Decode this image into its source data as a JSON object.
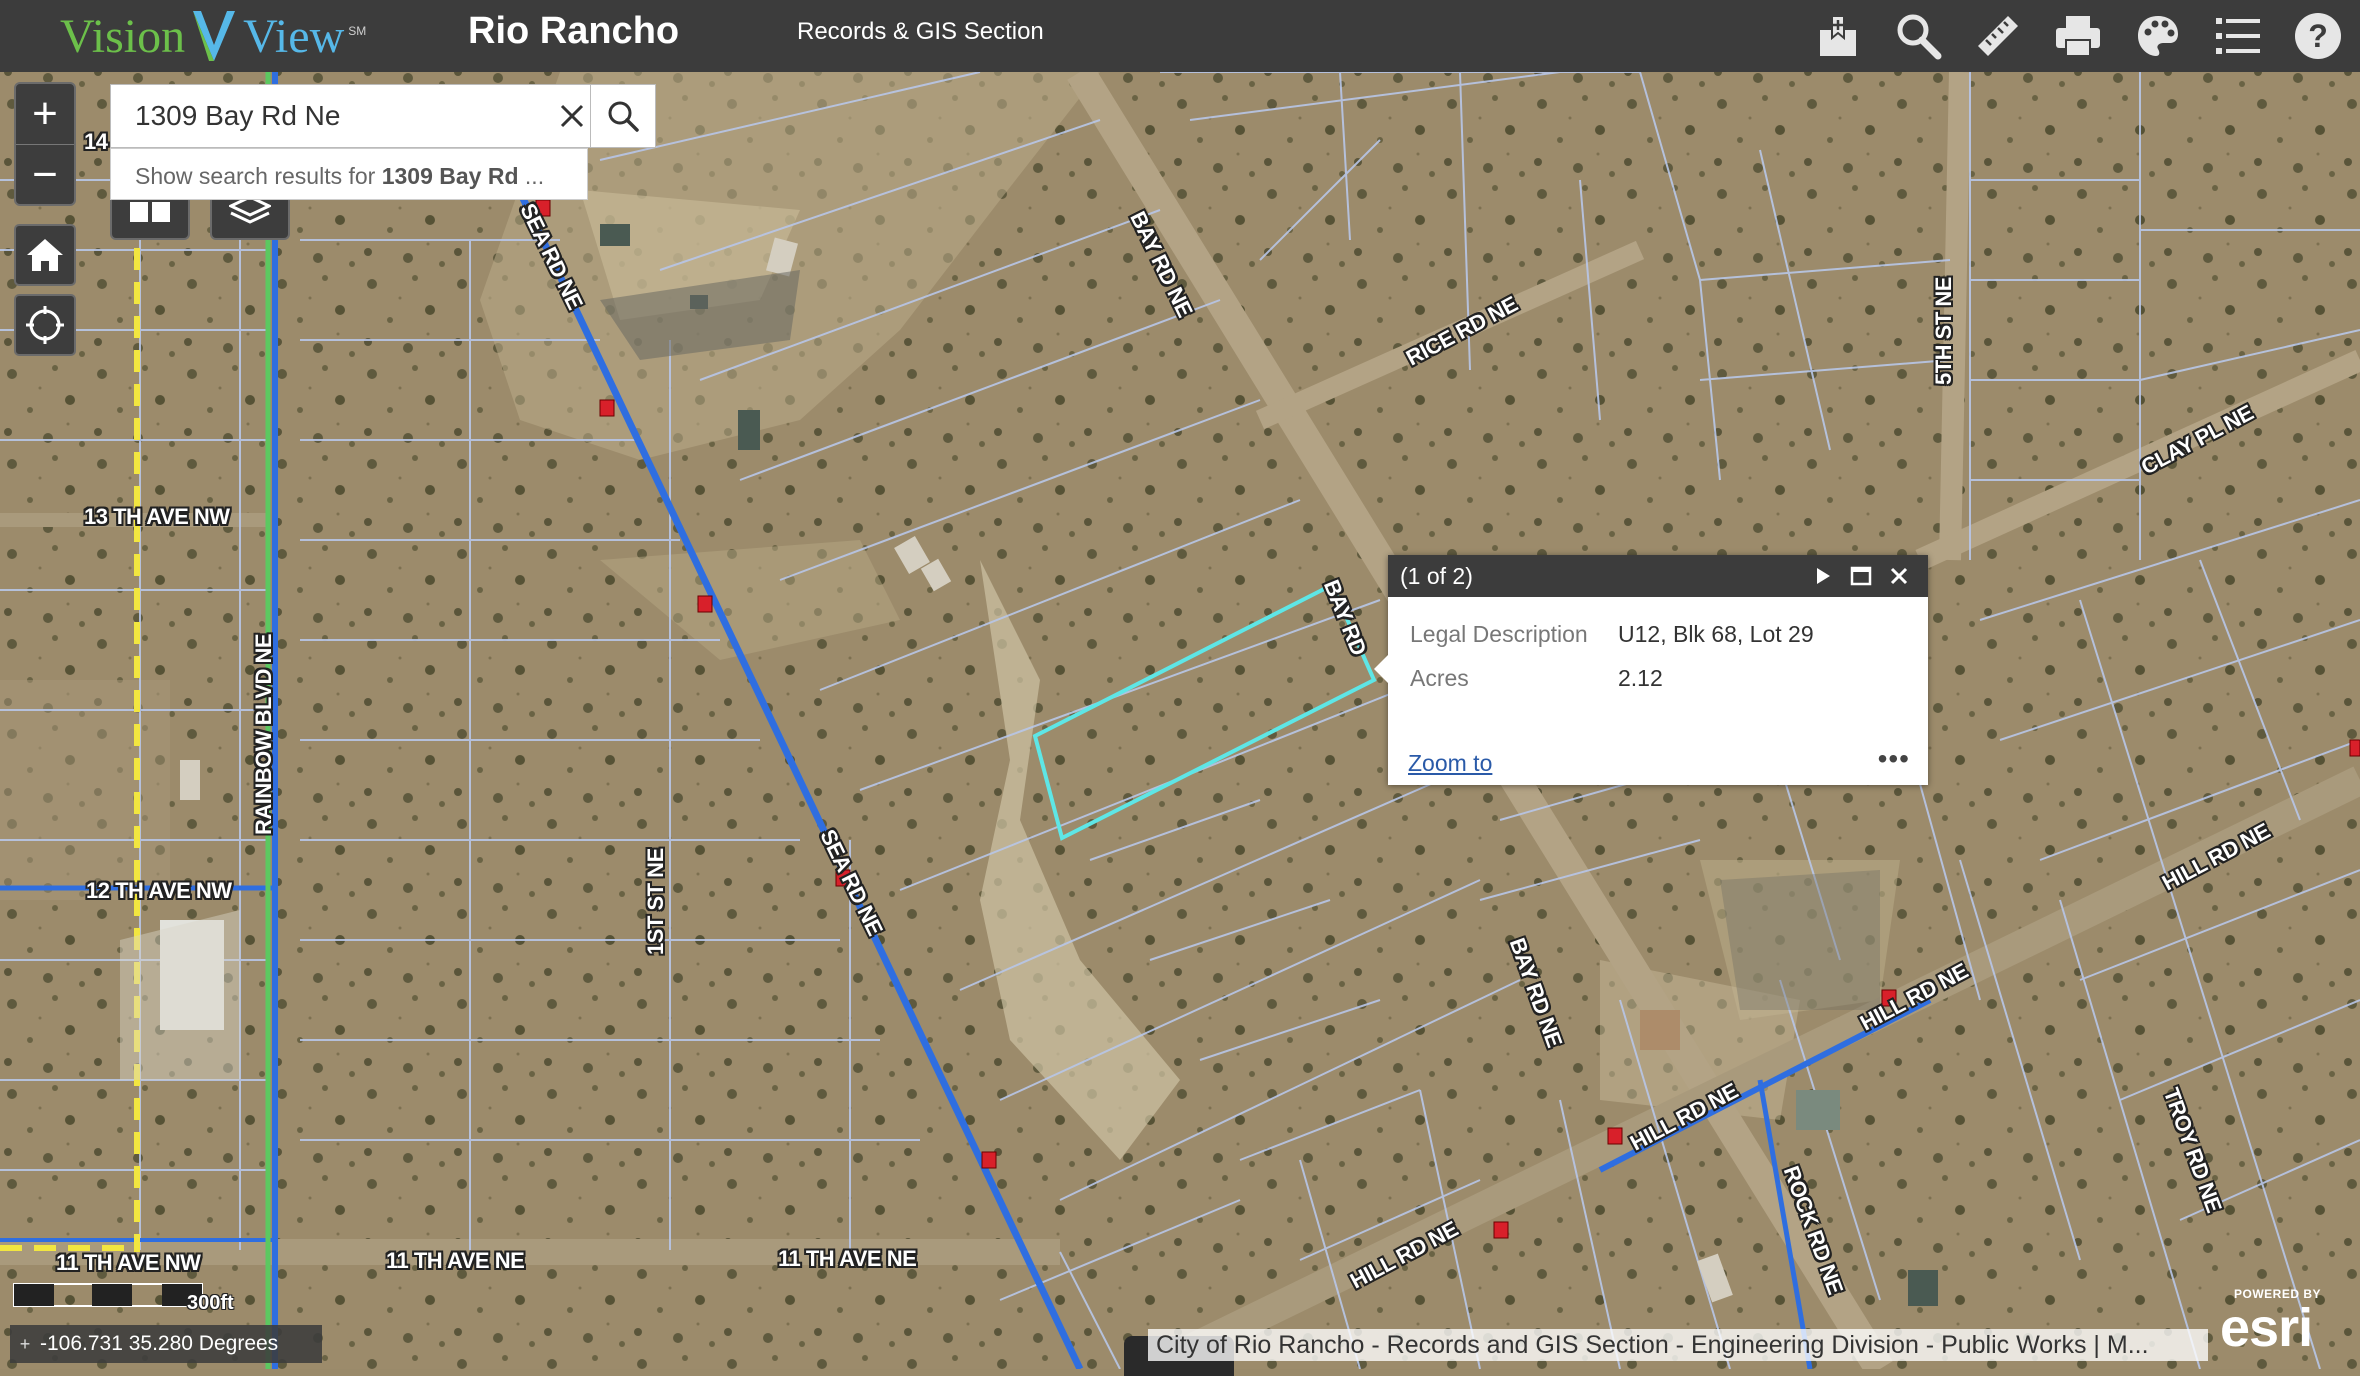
{
  "header": {
    "logo_vision": "Vision",
    "logo_view": "View",
    "logo_sm": "SM",
    "app_title": "Rio Rancho",
    "section_title": "Records & GIS Section",
    "tools": [
      {
        "name": "bookmark-icon"
      },
      {
        "name": "search-icon"
      },
      {
        "name": "measure-ruler-icon"
      },
      {
        "name": "print-icon"
      },
      {
        "name": "basemap-palette-icon"
      },
      {
        "name": "legend-list-icon"
      },
      {
        "name": "help-icon"
      }
    ]
  },
  "search": {
    "value": "1309 Bay Rd Ne",
    "suggestion_prefix": "Show search results for ",
    "suggestion_bold": "1309 Bay Rd",
    "suggestion_suffix": " ..."
  },
  "zoom": {
    "in": "+",
    "out": "−"
  },
  "popup": {
    "count": "(1 of 2)",
    "fields": [
      {
        "key": "Legal Description",
        "value": "U12, Blk 68, Lot 29"
      },
      {
        "key": "Acres",
        "value": "2.12"
      }
    ],
    "zoom_to": "Zoom to",
    "more": "•••"
  },
  "map_labels": [
    {
      "text": "14",
      "name": "label-14th-ave"
    },
    {
      "text": "BAY RD NE",
      "name": "label-bay-rd-ne-top"
    },
    {
      "text": "RICE RD NE",
      "name": "label-rice-rd-ne"
    },
    {
      "text": "5TH ST NE",
      "name": "label-5th-st-ne"
    },
    {
      "text": "CLAY PL NE",
      "name": "label-clay-pl-ne"
    },
    {
      "text": "13 TH AVE NW",
      "name": "label-13th-ave-nw"
    },
    {
      "text": "BAY RD",
      "name": "label-bay-rd-mid"
    },
    {
      "text": "RAINBOW BLVD NE",
      "name": "label-rainbow-blvd-ne"
    },
    {
      "text": "12 TH AVE NW",
      "name": "label-12th-ave-nw"
    },
    {
      "text": "1ST ST NE",
      "name": "label-1st-st-ne"
    },
    {
      "text": "SEA RD NE",
      "name": "label-sea-rd-ne"
    },
    {
      "text": "BAY RD NE",
      "name": "label-bay-rd-ne-bottom"
    },
    {
      "text": "HILL RD NE",
      "name": "label-hill-rd-ne-right"
    },
    {
      "text": "HILL RD NE",
      "name": "label-hill-rd-ne-mid"
    },
    {
      "text": "HILL RD NE",
      "name": "label-hill-rd-ne-center"
    },
    {
      "text": "HILL RD NE",
      "name": "label-hill-rd-ne-low"
    },
    {
      "text": "TROY RD NE",
      "name": "label-troy-rd-ne"
    },
    {
      "text": "ROCK RD NE",
      "name": "label-rock-rd-ne"
    },
    {
      "text": "11 TH AVE NW",
      "name": "label-11th-ave-nw"
    },
    {
      "text": "11 TH AVE NE",
      "name": "label-11th-ave-ne-left"
    },
    {
      "text": "11 TH AVE NE",
      "name": "label-11th-ave-ne-right"
    },
    {
      "text": "SEA RD NE",
      "name": "label-sea-rd-ne-top"
    }
  ],
  "scale": {
    "label": "300ft"
  },
  "coords": {
    "text": "-106.731 35.280 Degrees"
  },
  "attribution": "City of Rio Rancho - Records and GIS Section - Engineering Division - Public Works | M...",
  "esri": {
    "powered_by": "POWERED BY",
    "brand": "esri"
  },
  "colors": {
    "header_bg": "#3c3c3c",
    "selection": "#5ee6e6",
    "parcel_line": "#b8c6e8",
    "road_blue": "#2f6ee0",
    "road_yellow": "#f2e640",
    "road_green": "#5cc860",
    "hydrant_red": "#d8202a"
  }
}
